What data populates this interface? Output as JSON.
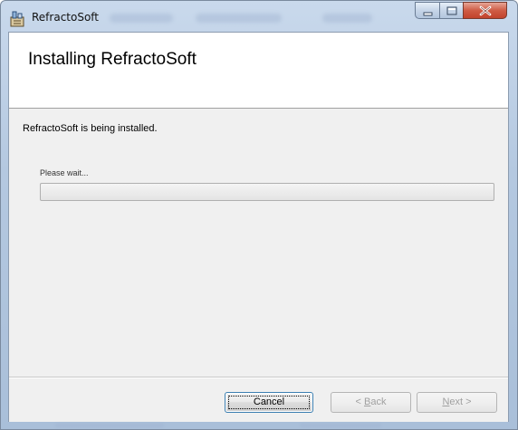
{
  "window": {
    "title": "RefractoSoft",
    "icon": "installer-app-icon",
    "controls": {
      "minimize": "minimize-icon",
      "maximize": "maximize-icon",
      "close": "close-icon"
    }
  },
  "banner": {
    "title": "Installing RefractoSoft"
  },
  "body": {
    "status": "RefractoSoft is being installed.",
    "progress_label": "Please wait...",
    "progress_value": 0
  },
  "footer": {
    "cancel": "Cancel",
    "back": {
      "prefix": "< ",
      "mnemonic": "B",
      "rest": "ack"
    },
    "next": {
      "mnemonic": "N",
      "rest": "ext",
      "suffix": " >"
    }
  },
  "colors": {
    "close_button": "#c2422c",
    "title_bar": "#b4c8e0",
    "dialog_bg": "#f0f0f0"
  }
}
